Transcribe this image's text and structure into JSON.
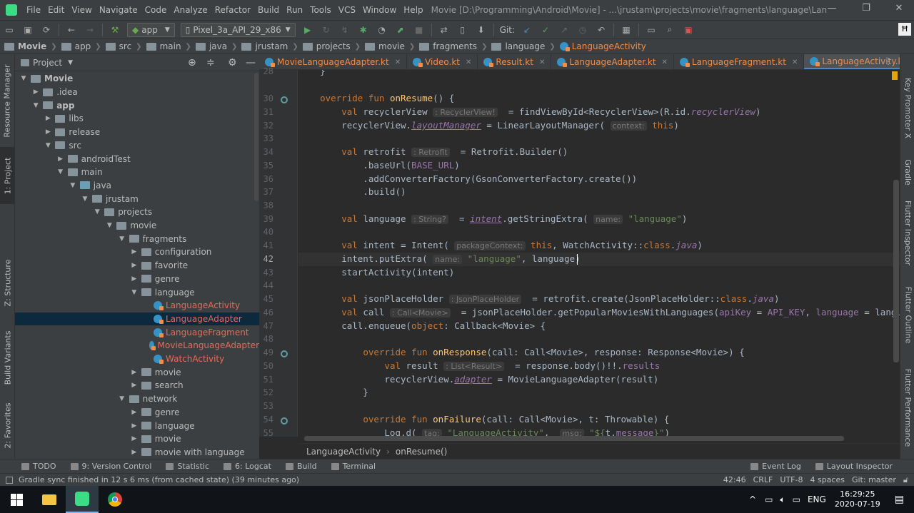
{
  "menubar": {
    "items": [
      "File",
      "Edit",
      "View",
      "Navigate",
      "Code",
      "Analyze",
      "Refactor",
      "Build",
      "Run",
      "Tools",
      "VCS",
      "Window",
      "Help"
    ],
    "title": "Movie [D:\\Programming\\Android\\Movie] - ...\\jrustam\\projects\\movie\\fragments\\language\\LanguageActivity.kt [app]"
  },
  "toolbar": {
    "module": "app",
    "device": "Pixel_3a_API_29_x86",
    "git_label": "Git:"
  },
  "breadcrumbs": [
    "Movie",
    "app",
    "src",
    "main",
    "java",
    "jrustam",
    "projects",
    "movie",
    "fragments",
    "language",
    "LanguageActivity"
  ],
  "project_panel": {
    "title": "Project",
    "tree": [
      {
        "label": "Movie",
        "depth": 0,
        "arrow": "open",
        "bold": true
      },
      {
        "label": ".idea",
        "depth": 1,
        "arrow": "closed"
      },
      {
        "label": "app",
        "depth": 1,
        "arrow": "open",
        "bold": true
      },
      {
        "label": "libs",
        "depth": 2,
        "arrow": "closed"
      },
      {
        "label": "release",
        "depth": 2,
        "arrow": "closed"
      },
      {
        "label": "src",
        "depth": 2,
        "arrow": "open"
      },
      {
        "label": "androidTest",
        "depth": 3,
        "arrow": "closed"
      },
      {
        "label": "main",
        "depth": 3,
        "arrow": "open"
      },
      {
        "label": "java",
        "depth": 4,
        "arrow": "open",
        "blue": true
      },
      {
        "label": "jrustam",
        "depth": 5,
        "arrow": "open"
      },
      {
        "label": "projects",
        "depth": 6,
        "arrow": "open"
      },
      {
        "label": "movie",
        "depth": 7,
        "arrow": "open"
      },
      {
        "label": "fragments",
        "depth": 8,
        "arrow": "open"
      },
      {
        "label": "configuration",
        "depth": 9,
        "arrow": "closed"
      },
      {
        "label": "favorite",
        "depth": 9,
        "arrow": "closed"
      },
      {
        "label": "genre",
        "depth": 9,
        "arrow": "closed"
      },
      {
        "label": "language",
        "depth": 9,
        "arrow": "open"
      },
      {
        "label": "LanguageActivity",
        "depth": 10,
        "kt": true
      },
      {
        "label": "LanguageAdapter",
        "depth": 10,
        "kt": true,
        "selected": true
      },
      {
        "label": "LanguageFragment",
        "depth": 10,
        "kt": true
      },
      {
        "label": "MovieLanguageAdapter",
        "depth": 10,
        "kt": true
      },
      {
        "label": "WatchActivity",
        "depth": 10,
        "kt": true
      },
      {
        "label": "movie",
        "depth": 9,
        "arrow": "closed"
      },
      {
        "label": "search",
        "depth": 9,
        "arrow": "closed"
      },
      {
        "label": "network",
        "depth": 8,
        "arrow": "open"
      },
      {
        "label": "genre",
        "depth": 9,
        "arrow": "closed"
      },
      {
        "label": "language",
        "depth": 9,
        "arrow": "closed"
      },
      {
        "label": "movie",
        "depth": 9,
        "arrow": "closed"
      },
      {
        "label": "movie with language",
        "depth": 9,
        "arrow": "closed"
      }
    ]
  },
  "left_strip": [
    "Resource Manager",
    "1: Project",
    "Z: Structure",
    "Build Variants",
    "2: Favorites"
  ],
  "right_strip": [
    "Key Promoter X",
    "Gradle",
    "Flutter Inspector",
    "Flutter Outline",
    "Flutter Performance"
  ],
  "editor_tabs": [
    {
      "label": "MovieLanguageAdapter.kt"
    },
    {
      "label": "Video.kt"
    },
    {
      "label": "Result.kt"
    },
    {
      "label": "LanguageAdapter.kt"
    },
    {
      "label": "LanguageFragment.kt"
    },
    {
      "label": "LanguageActivity.kt",
      "active": true
    },
    {
      "label": "Wat"
    }
  ],
  "line_numbers": [
    "28",
    "30",
    "31",
    "32",
    "33",
    "34",
    "35",
    "36",
    "37",
    "38",
    "39",
    "40",
    "41",
    "42",
    "43",
    "44",
    "45",
    "46",
    "47",
    "48",
    "49",
    "50",
    "51",
    "52",
    "53",
    "54",
    "55"
  ],
  "current_line": "42",
  "editor_breadcrumb": [
    "LanguageActivity",
    "onResume()"
  ],
  "bottom_tabs": [
    "TODO",
    "9: Version Control",
    "Statistic",
    "6: Logcat",
    "Build",
    "Terminal"
  ],
  "bottom_right_tabs": [
    "Event Log",
    "Layout Inspector"
  ],
  "status": {
    "message": "Gradle sync finished in 12 s 6 ms (from cached state) (39 minutes ago)",
    "position": "42:46",
    "line_sep": "CRLF",
    "encoding": "UTF-8",
    "indent": "4 spaces",
    "branch": "Git: master"
  },
  "taskbar": {
    "lang": "ENG",
    "time": "16:29:25",
    "date": "2020-07-19"
  }
}
